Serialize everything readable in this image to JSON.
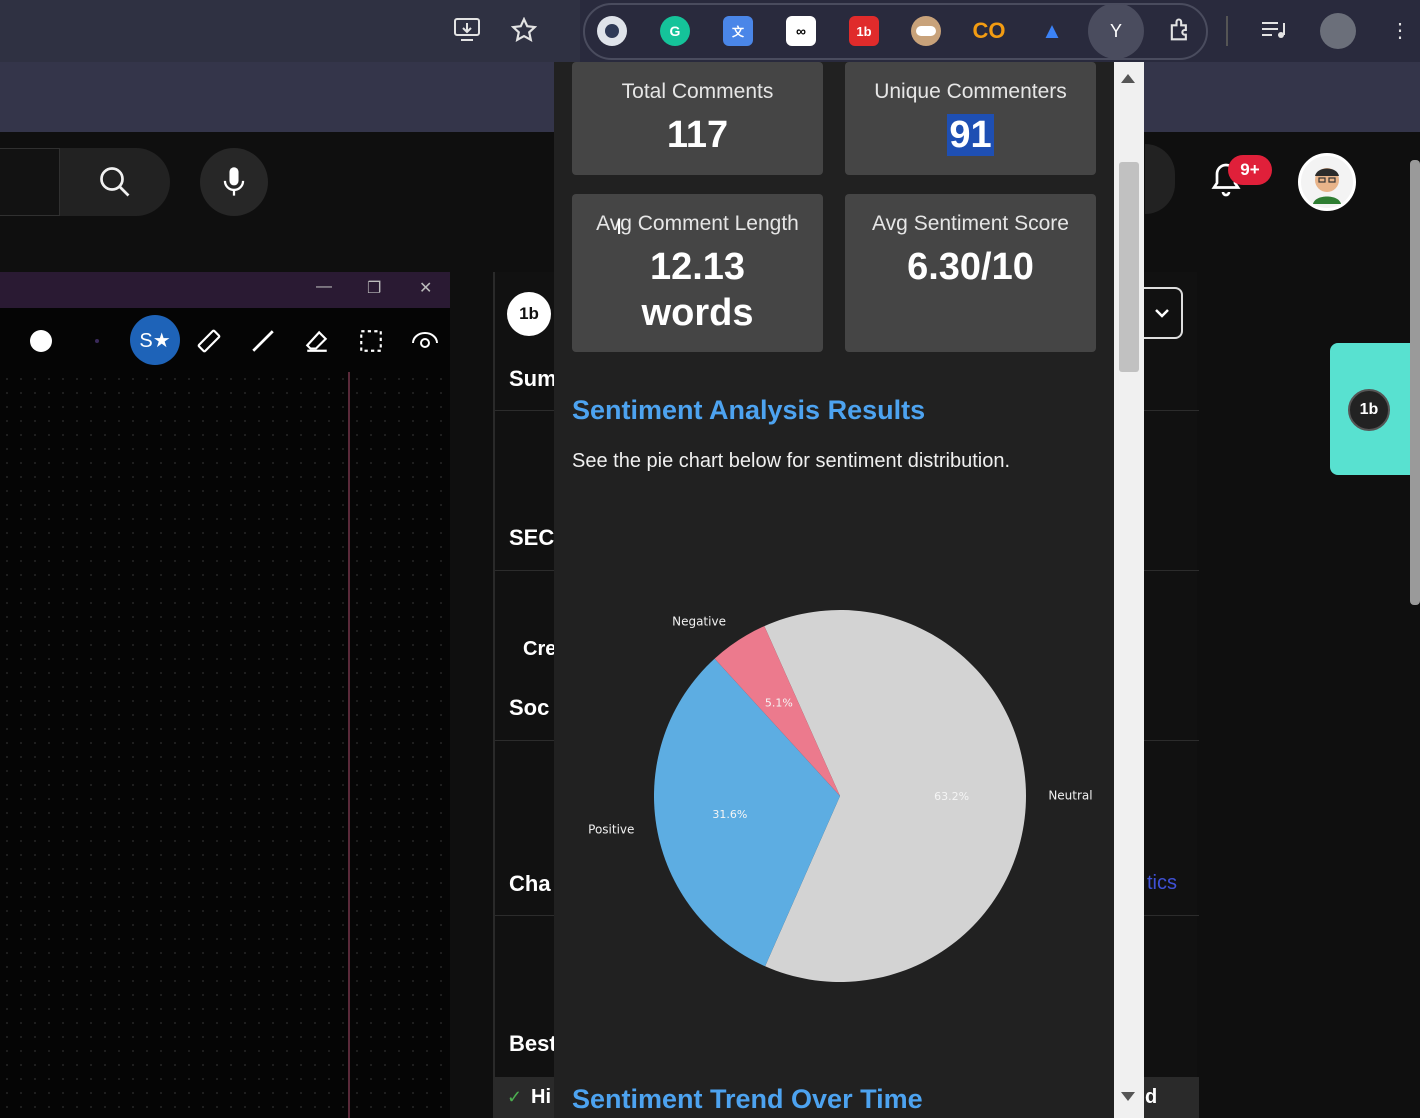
{
  "browser": {
    "extension_y_label": "Y"
  },
  "page": {
    "notification_badge": "9+",
    "behind_labels": [
      "Sum",
      "SEC",
      "Cre",
      "Soc",
      "Cha",
      "Best",
      "Hi"
    ],
    "behind_right_link": "tics",
    "behind_right_letter": "d"
  },
  "stats": {
    "total_comments_label": "Total Comments",
    "total_comments_value": "117",
    "unique_commenters_label": "Unique Commenters",
    "unique_commenters_value": "91",
    "avg_length_label": "Avg Comment Length",
    "avg_length_value_line1": "12.13",
    "avg_length_value_line2": "words",
    "avg_sentiment_label": "Avg Sentiment Score",
    "avg_sentiment_value": "6.30/10"
  },
  "sections": {
    "sentiment_heading": "Sentiment Analysis Results",
    "sentiment_desc": "See the pie chart below for sentiment distribution.",
    "trend_heading": "Sentiment Trend Over Time"
  },
  "chart_data": {
    "type": "pie",
    "slices": [
      {
        "label": "Neutral",
        "value": 63.2,
        "display": "63.2%",
        "color": "#d3d3d3"
      },
      {
        "label": "Positive",
        "value": 31.6,
        "display": "31.6%",
        "color": "#5dade2"
      },
      {
        "label": "Negative",
        "value": 5.1,
        "display": "5.1%",
        "color": "#ec7a8d"
      }
    ]
  },
  "colors": {
    "accent_blue": "#4da3f0",
    "card_bg": "#454545",
    "popup_bg": "#212121",
    "teal": "#58e1d0",
    "badge_red": "#e0203a"
  }
}
